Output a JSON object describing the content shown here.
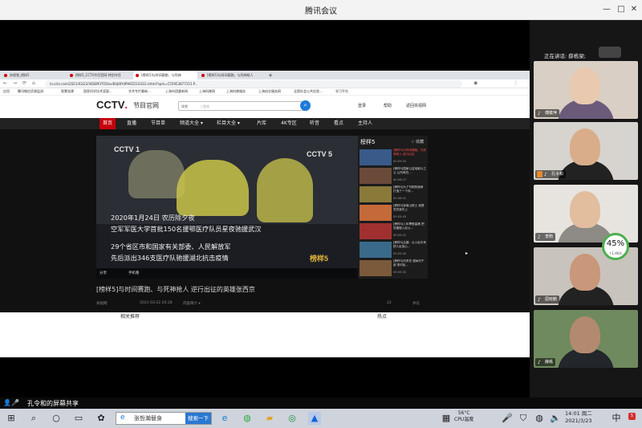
{
  "window": {
    "title": "腾讯会议",
    "min_icon": "minimize-icon",
    "max_icon": "maximize-icon",
    "close_icon": "close-icon"
  },
  "browser": {
    "tabs": [
      {
        "label": "央视频_榜样5",
        "active": false
      },
      {
        "label": "榜样5_CCTV节目官网-特别节目",
        "active": false
      },
      {
        "label": "[榜样5]与时间赛跑、与死神",
        "active": true
      },
      {
        "label": "[榜样5]与时间赛跑，与死神抢人",
        "active": false
      }
    ],
    "url": "tv.cctv.com/2021/03/22/VIDEM3TOOxvlEHjI8YdPHRZ210322.shtml?spm=C55953877151.P...",
    "bookmarks": [
      "应用",
      "腾讯微信资源监测",
      "智慧党建",
      "国家科学技术奖励...",
      "学术专栏最新...",
      "上海市团委新闻",
      "上海科普网",
      "上海科普服务",
      "上海创业服务网",
      "全国社会公共信息...",
      "学习平台"
    ]
  },
  "site": {
    "logo_main": "CCTV",
    "logo_dot": ".",
    "logo_sub": "节目官网",
    "search_select": "视频",
    "search_placeholder": "三星堆",
    "header_links": [
      "登录",
      "帮助",
      "返回央视网"
    ],
    "nav": [
      "首页",
      "直播",
      "节目单",
      "频道大全 ▾",
      "栏目大全 ▾",
      "片库",
      "4K专区",
      "听音",
      "看点",
      "主持人"
    ],
    "player": {
      "watermark1": "CCTV 1",
      "watermark2": "CCTV 5",
      "watermark3": "榜样5",
      "captions": [
        "2020年1月24日 农历除夕夜",
        "空军军医大学首批150名援鄂医疗队员星夜驰援武汉",
        "29个省区市和国家有关部委、人民解放军",
        "先后派出346支医疗队驰援湖北抗击疫情"
      ],
      "share": "分享",
      "mobile": "手机看"
    },
    "playlist": {
      "title": "榜样5",
      "fav": "收藏",
      "items": [
        {
          "title": "[榜样5]与时间赛跑、与死神抢人 逆行出征",
          "time": "00:05:53",
          "selected": true
        },
        {
          "title": "[榜样5]国家公益电影片之父 让所有的...",
          "time": "00:06:27",
          "selected": false
        },
        {
          "title": "[榜样5]为了刊物的使命 打造了一个传...",
          "time": "00:06:41",
          "selected": false
        },
        {
          "title": "[榜样5]钟南山院士 我是党员我先上",
          "time": "00:05:45",
          "selected": false
        },
        {
          "title": "[榜样5]八年攀登高峰 把党建做入民心...",
          "time": "00:05:41",
          "selected": false
        },
        {
          "title": "[榜样5]吕建：从人民中来 把人民放心...",
          "time": "00:05:40",
          "selected": false
        },
        {
          "title": "[榜样5]刘贵芳 退休村干部 带村民...",
          "time": "00:05:32",
          "selected": false
        }
      ]
    },
    "video_title": "[榜样5]与时间赛跑、与死神抢人 逆行出征的英雄张西京",
    "meta": {
      "source": "央视网",
      "date": "2021-03-22 20:28",
      "intro": "内容简介 ▾",
      "likes": "22",
      "comment": "评论"
    },
    "lower": [
      "相关推荐",
      "热点"
    ]
  },
  "meeting": {
    "speaker_label": "正在讲话: 薛栋梁;",
    "participants": [
      {
        "name": "傅筱萍",
        "colors": {
          "bg": "#d9cfc4",
          "face": "#e9c9b0",
          "body": "#6b5a7a"
        }
      },
      {
        "name": "孔令和",
        "colors": {
          "bg": "#d7d3ce",
          "face": "#d9ad8a",
          "body": "#222222"
        },
        "host": true
      },
      {
        "name": "李煦",
        "colors": {
          "bg": "#e7e4df",
          "face": "#e2bd9e",
          "body": "#8e8a85"
        }
      },
      {
        "name": "屈晓鹏",
        "colors": {
          "bg": "#c9c3bd",
          "face": "#c9977a",
          "body": "#222222"
        }
      },
      {
        "name": "薛栋",
        "colors": {
          "bg": "#6f8a5e",
          "face": "#b28a70",
          "body": "#23262b"
        }
      }
    ],
    "network": {
      "percent": "45%",
      "speed": "↑1.4K/s"
    },
    "share_text": "孔令和的屏幕共享"
  },
  "taskbar": {
    "search_text": "张哲瀚替身",
    "search_btn": "搜索一下",
    "temp": "56°C",
    "temp_label": "CPU温度",
    "time": "14:01 周二",
    "date": "2021/3/23",
    "notif": "5"
  }
}
